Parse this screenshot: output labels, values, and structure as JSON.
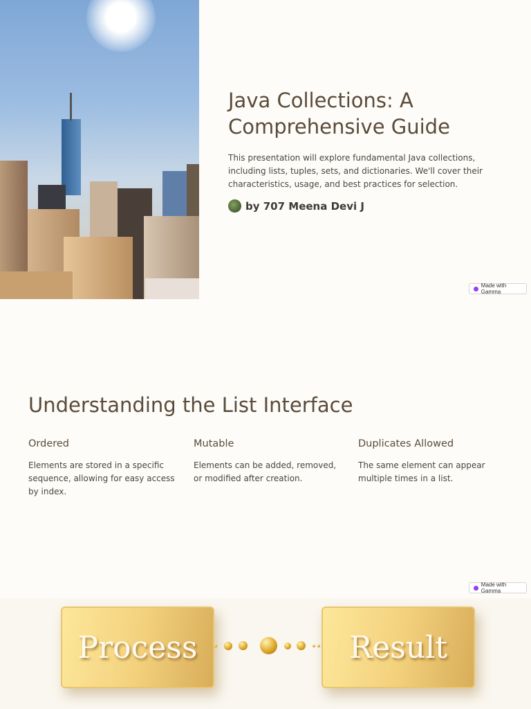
{
  "slide1": {
    "title": "Java Collections: A Comprehensive Guide",
    "description": "This presentation will explore fundamental Java collections, including lists, tuples, sets, and dictionaries. We'll cover their characteristics, usage, and best practices for selection.",
    "author": "by 707 Meena Devi J",
    "badge": "Made with Gamma"
  },
  "slide2": {
    "title": "Understanding the List Interface",
    "columns": [
      {
        "heading": "Ordered",
        "text": "Elements are stored in a specific sequence, allowing for easy access by index."
      },
      {
        "heading": "Mutable",
        "text": "Elements can be added, removed, or modified after creation."
      },
      {
        "heading": "Duplicates Allowed",
        "text": "The same element can appear multiple times in a list."
      }
    ],
    "badge": "Made with Gamma"
  },
  "slide3": {
    "image_labels": [
      "Process",
      "Result"
    ]
  }
}
